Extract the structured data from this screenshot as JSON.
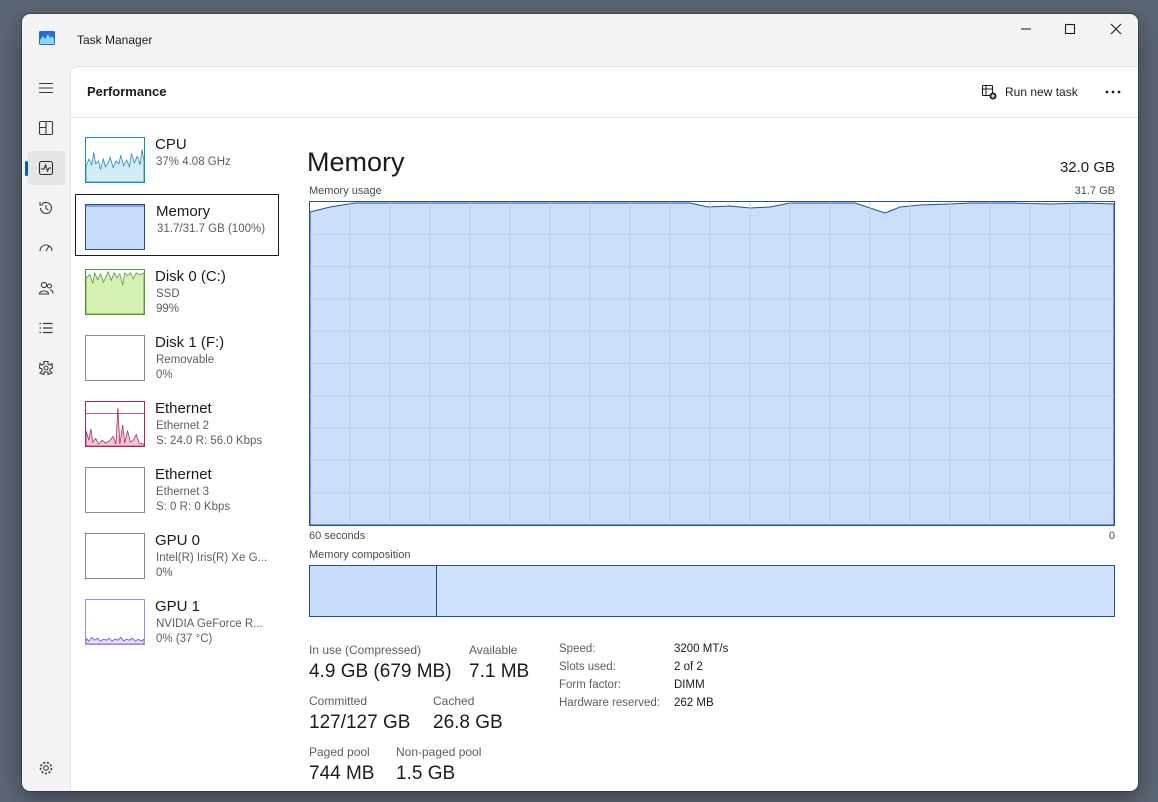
{
  "window": {
    "title": "Task Manager",
    "controls": [
      "minimize-icon",
      "maximize-icon",
      "close-icon"
    ]
  },
  "nav": {
    "items": [
      {
        "icon": "hamburger-icon"
      },
      {
        "icon": "processes-icon"
      },
      {
        "icon": "performance-icon",
        "active": true
      },
      {
        "icon": "app-history-icon"
      },
      {
        "icon": "startup-apps-icon"
      },
      {
        "icon": "users-icon"
      },
      {
        "icon": "details-icon"
      },
      {
        "icon": "services-icon"
      },
      {
        "icon": "settings-icon"
      }
    ]
  },
  "header": {
    "title": "Performance",
    "run_new_task": "Run new task",
    "more": "..."
  },
  "devices": [
    {
      "name": "CPU",
      "sub1": "37%  4.08 GHz",
      "sub2": ""
    },
    {
      "name": "Memory",
      "sub1": "31.7/31.7 GB (100%)",
      "sub2": ""
    },
    {
      "name": "Disk 0 (C:)",
      "sub1": "SSD",
      "sub2": "99%"
    },
    {
      "name": "Disk 1 (F:)",
      "sub1": "Removable",
      "sub2": "0%"
    },
    {
      "name": "Ethernet",
      "sub1": "Ethernet 2",
      "sub2": "S: 24.0  R: 56.0 Kbps"
    },
    {
      "name": "Ethernet",
      "sub1": "Ethernet 3",
      "sub2": "S: 0  R: 0 Kbps"
    },
    {
      "name": "GPU 0",
      "sub1": "Intel(R) Iris(R) Xe G...",
      "sub2": "0%"
    },
    {
      "name": "GPU 1",
      "sub1": "NVIDIA GeForce R...",
      "sub2": "0%  (37 °C)"
    }
  ],
  "memory": {
    "title": "Memory",
    "total": "32.0 GB",
    "usage_label": "Memory usage",
    "usage_max": "31.7 GB",
    "time_left": "60 seconds",
    "time_right": "0",
    "composition_label": "Memory composition",
    "stats": {
      "in_use_label": "In use (Compressed)",
      "in_use": "4.9 GB (679 MB)",
      "available_label": "Available",
      "available": "7.1 MB",
      "committed_label": "Committed",
      "committed": "127/127 GB",
      "cached_label": "Cached",
      "cached": "26.8 GB",
      "paged_label": "Paged pool",
      "paged": "744 MB",
      "nonpaged_label": "Non-paged pool",
      "nonpaged": "1.5 GB"
    },
    "details": [
      {
        "key": "Speed:",
        "value": "3200 MT/s"
      },
      {
        "key": "Slots used:",
        "value": "2 of 2"
      },
      {
        "key": "Form factor:",
        "value": "DIMM"
      },
      {
        "key": "Hardware reserved:",
        "value": "262 MB"
      }
    ]
  },
  "colors": {
    "memory_fill": "#c7dcf8",
    "memory_line": "#1e4f9e",
    "cpu_line": "#1f8ab0",
    "disk_fill": "#d5f0b5",
    "disk_line": "#4c9a2a",
    "ethernet_line": "#b0245e",
    "gpu_line": "#7a3fc7",
    "accent": "#005fb8"
  }
}
